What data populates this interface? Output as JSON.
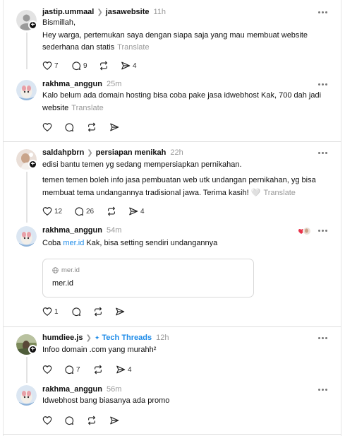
{
  "posts": [
    {
      "username": "jastip.ummaal",
      "topic": "jasawebsite",
      "time": "11h",
      "body_lines": [
        "Bismillah,",
        "Hey warga, pertemukan saya dengan siapa saja yang mau membuat website",
        "sederhana dan statis"
      ],
      "translate": "Translate",
      "likes": "7",
      "comments": "9",
      "shares": "4"
    },
    {
      "username": "rakhma_anggun",
      "time": "25m",
      "body_lines": [
        "Kalo belum ada domain hosting bisa coba pake jasa idwebhost Kak, 700 dah jadi",
        "website"
      ],
      "translate": "Translate"
    },
    {
      "username": "saldahpbrn",
      "topic": "persiapan menikah",
      "time": "22h",
      "body_line1": "edisi bantu temen yg sedang mempersiapkan pernikahan.",
      "body_lines": [
        "temen temen boleh info jasa pembuatan web utk undangan pernikahan, yg bisa",
        "membuat tema undangannya tradisional jawa. Terima kasih! 🤍"
      ],
      "translate": "Translate",
      "likes": "12",
      "comments": "26",
      "shares": "4"
    },
    {
      "username": "rakhma_anggun",
      "time": "54m",
      "body_prefix": "Coba ",
      "body_link": "mer.id",
      "body_suffix": " Kak, bisa setting sendiri undangannya",
      "card_domain": "mer.id",
      "card_title": "mer.id",
      "likes": "1"
    },
    {
      "username": "humdiee.js",
      "topic": "Tech Threads",
      "time": "12h",
      "body": "Infoo domain .com yang murahh²",
      "comments": "7",
      "shares": "4"
    },
    {
      "username": "rakhma_anggun",
      "time": "56m",
      "body": "Idwebhost bang biasanya ada promo"
    }
  ],
  "icons": {
    "like": "heart-icon",
    "comment": "comment-icon",
    "repost": "repost-icon",
    "share": "share-icon",
    "more": "more-icon",
    "globe": "globe-icon",
    "follow": "plus-icon"
  },
  "colors": {
    "link": "#1d8be8",
    "muted": "#999999",
    "text": "#101010"
  }
}
